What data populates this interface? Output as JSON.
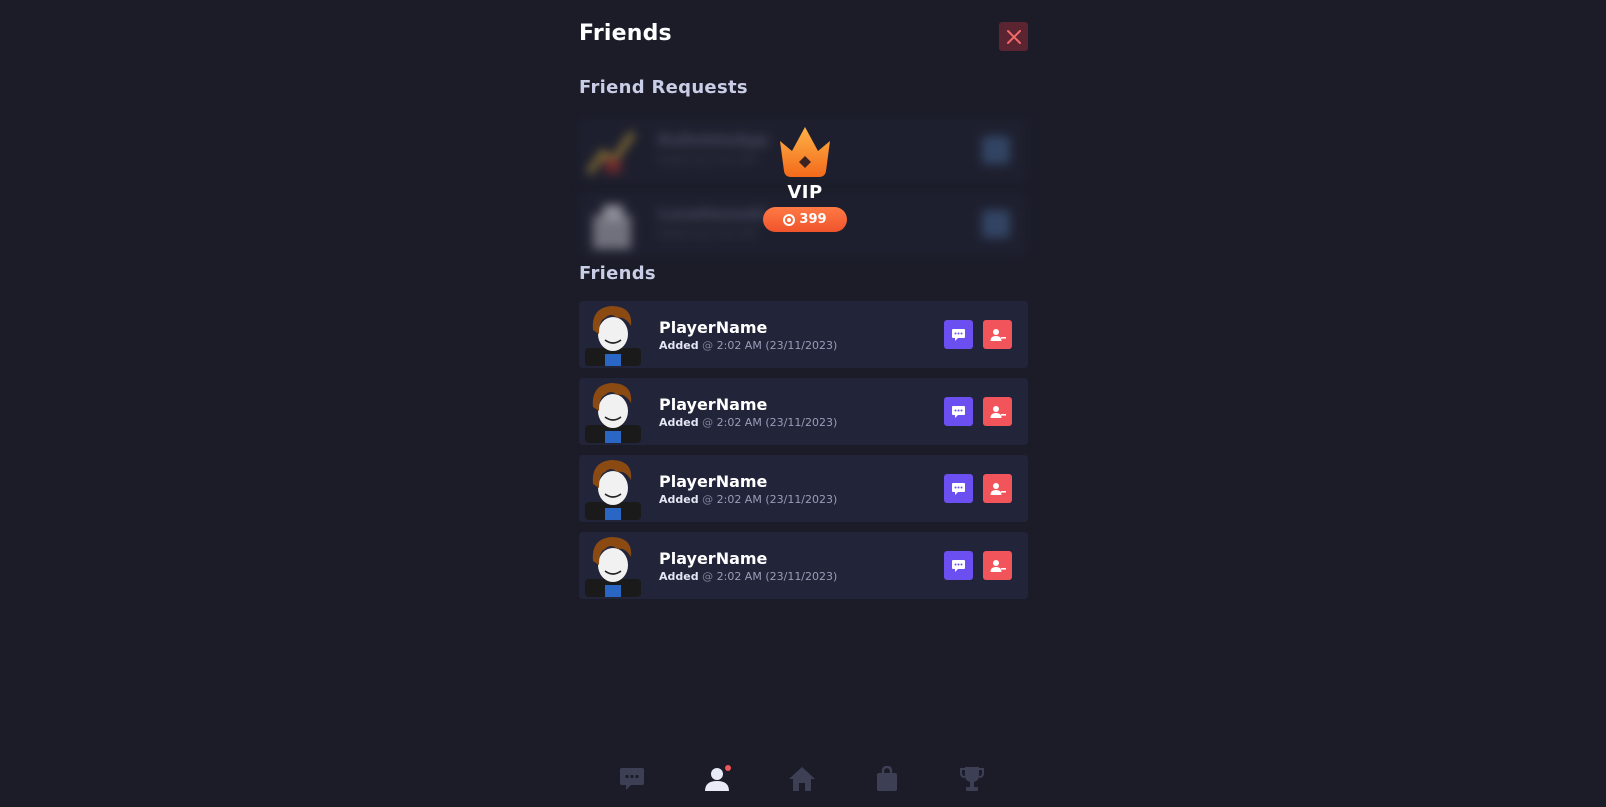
{
  "header": {
    "title": "Friends",
    "close_icon": "close-icon"
  },
  "requests": {
    "section_title": "Friend Requests",
    "items": [
      {
        "name": "RoDeleteApp",
        "subtitle": "Added @ 2:02 AM"
      },
      {
        "name": "LunaHaneeki",
        "subtitle": "Added @ 2:02 AM"
      }
    ],
    "vip": {
      "label": "VIP",
      "price": "399",
      "icon": "crown-icon",
      "currency_icon": "coin-icon"
    }
  },
  "friends": {
    "section_title": "Friends",
    "items": [
      {
        "name": "PlayerName",
        "added_label": "Added",
        "at": "@",
        "time": "2:02 AM (23/11/2023)"
      },
      {
        "name": "PlayerName",
        "added_label": "Added",
        "at": "@",
        "time": "2:02 AM (23/11/2023)"
      },
      {
        "name": "PlayerName",
        "added_label": "Added",
        "at": "@",
        "time": "2:02 AM (23/11/2023)"
      },
      {
        "name": "PlayerName",
        "added_label": "Added",
        "at": "@",
        "time": "2:02 AM (23/11/2023)"
      }
    ]
  },
  "nav": {
    "items": [
      {
        "icon": "chat-icon",
        "active": false
      },
      {
        "icon": "friends-icon",
        "active": true,
        "notification": true
      },
      {
        "icon": "home-icon",
        "active": false
      },
      {
        "icon": "shop-bag-icon",
        "active": false
      },
      {
        "icon": "trophy-icon",
        "active": false
      }
    ]
  },
  "colors": {
    "background": "#1b1c28",
    "row": "#22243a",
    "chat_button": "#6b4ff0",
    "remove_button": "#f2545b",
    "close_button": "#5a2530",
    "vip_gradient_start": "#ff7a45",
    "vip_gradient_end": "#f0542b",
    "nav_inactive": "#3d4055",
    "nav_active": "#e8eaf6"
  }
}
